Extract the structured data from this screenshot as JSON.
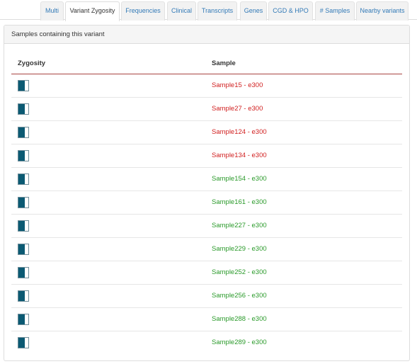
{
  "tabs": [
    {
      "label": "Multi",
      "active": false
    },
    {
      "label": "Variant Zygosity",
      "active": true
    },
    {
      "label": "Frequencies",
      "active": false
    },
    {
      "label": "Clinical",
      "active": false
    },
    {
      "label": "Transcripts",
      "active": false
    },
    {
      "label": "Genes",
      "active": false
    },
    {
      "label": "CGD & HPO",
      "active": false
    },
    {
      "label": "# Samples",
      "active": false
    },
    {
      "label": "Nearby variants",
      "active": false
    }
  ],
  "panel": {
    "title": "Samples containing this variant",
    "columns": {
      "zygosity": "Zygosity",
      "sample": "Sample"
    },
    "rows": [
      {
        "sample": "Sample15 - e300",
        "status": "red",
        "zygosity_icon": "heterozygous-icon"
      },
      {
        "sample": "Sample27 - e300",
        "status": "red",
        "zygosity_icon": "heterozygous-icon"
      },
      {
        "sample": "Sample124 - e300",
        "status": "red",
        "zygosity_icon": "heterozygous-icon"
      },
      {
        "sample": "Sample134 - e300",
        "status": "red",
        "zygosity_icon": "heterozygous-icon"
      },
      {
        "sample": "Sample154 - e300",
        "status": "green",
        "zygosity_icon": "heterozygous-icon"
      },
      {
        "sample": "Sample161 - e300",
        "status": "green",
        "zygosity_icon": "heterozygous-icon"
      },
      {
        "sample": "Sample227 - e300",
        "status": "green",
        "zygosity_icon": "heterozygous-icon"
      },
      {
        "sample": "Sample229 - e300",
        "status": "green",
        "zygosity_icon": "heterozygous-icon"
      },
      {
        "sample": "Sample252 - e300",
        "status": "green",
        "zygosity_icon": "heterozygous-icon"
      },
      {
        "sample": "Sample256 - e300",
        "status": "green",
        "zygosity_icon": "heterozygous-icon"
      },
      {
        "sample": "Sample288 - e300",
        "status": "green",
        "zygosity_icon": "heterozygous-icon"
      },
      {
        "sample": "Sample289 - e300",
        "status": "green",
        "zygosity_icon": "heterozygous-icon"
      }
    ]
  },
  "colors": {
    "red": "#d12020",
    "green": "#2a9a2a",
    "header_rule": "#a94442",
    "zygosity_fill": "#0b5a73",
    "link": "#337ab7"
  }
}
